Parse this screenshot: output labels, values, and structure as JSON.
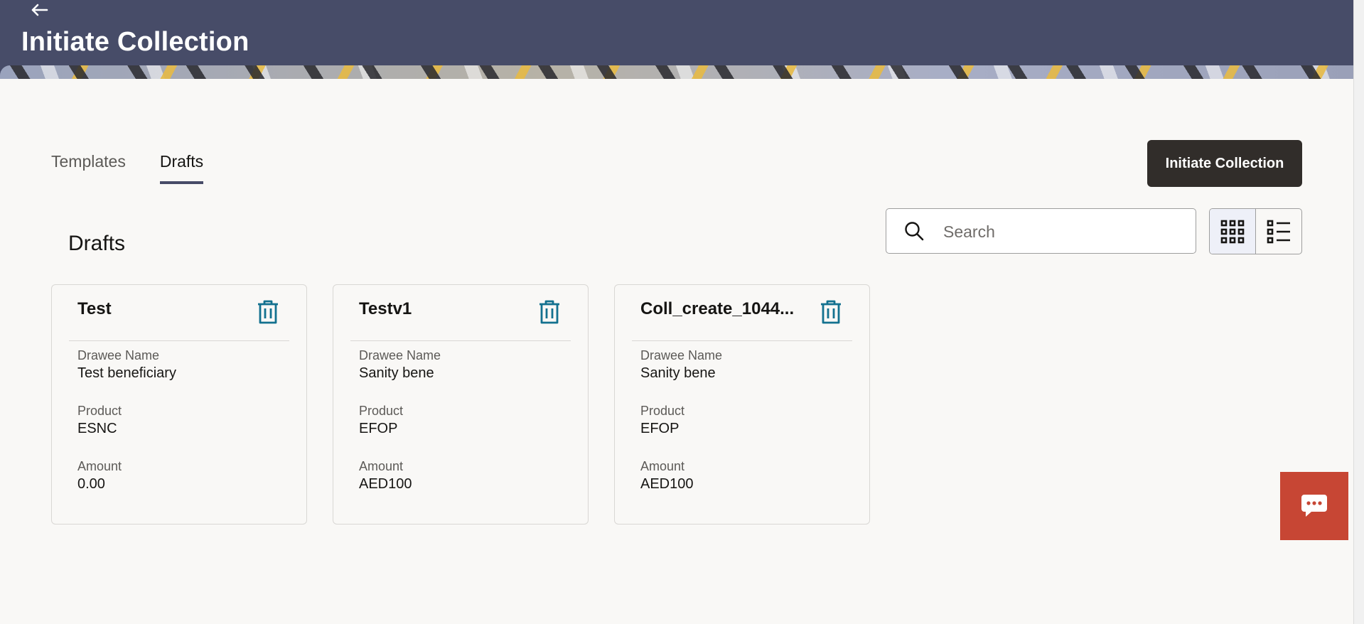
{
  "header": {
    "title": "Initiate Collection"
  },
  "tabs": [
    {
      "label": "Templates",
      "active": false
    },
    {
      "label": "Drafts",
      "active": true
    }
  ],
  "actions": {
    "initiate_label": "Initiate Collection"
  },
  "section": {
    "title": "Drafts"
  },
  "search": {
    "placeholder": "Search",
    "value": ""
  },
  "view_toggle": {
    "selected": "grid"
  },
  "drafts": [
    {
      "title": "Test",
      "drawee_label": "Drawee Name",
      "drawee": "Test beneficiary",
      "product_label": "Product",
      "product": "ESNC",
      "amount_label": "Amount",
      "amount": "0.00"
    },
    {
      "title": "Testv1",
      "drawee_label": "Drawee Name",
      "drawee": "Sanity bene",
      "product_label": "Product",
      "product": "EFOP",
      "amount_label": "Amount",
      "amount": "AED100"
    },
    {
      "title": "Coll_create_1044...",
      "drawee_label": "Drawee Name",
      "drawee": "Sanity bene",
      "product_label": "Product",
      "product": "EFOP",
      "amount_label": "Amount",
      "amount": "AED100"
    }
  ],
  "icons": {
    "back": "arrow-left-icon",
    "search": "search-icon",
    "delete": "trash-icon",
    "grid": "grid-view-icon",
    "list": "list-view-icon",
    "chat": "chat-icon"
  },
  "colors": {
    "header_bg": "#474c68",
    "primary_button": "#312d2a",
    "icon_teal": "#13718f",
    "chat_button": "#c74634"
  }
}
